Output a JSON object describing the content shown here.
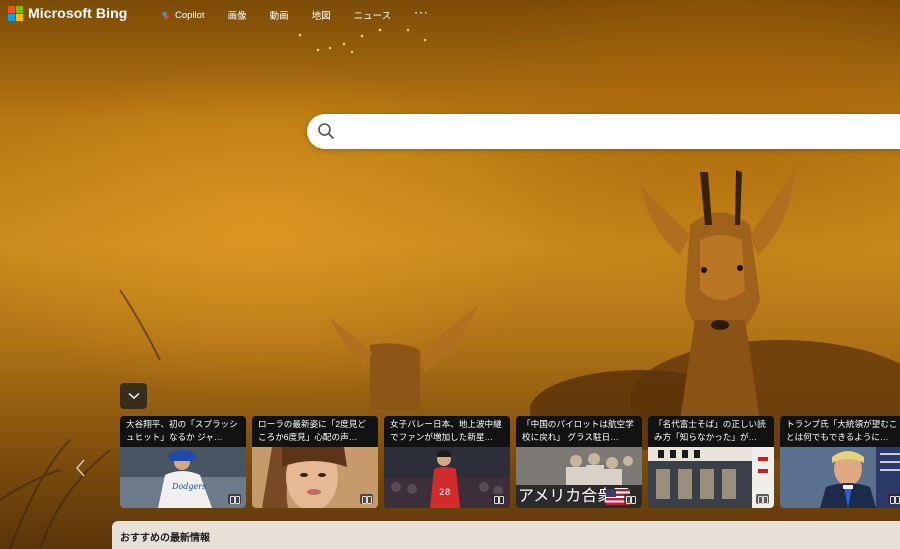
{
  "brand": {
    "name": "Microsoft Bing",
    "logo_colors": [
      "#f25022",
      "#7fba00",
      "#00a4ef",
      "#ffb900"
    ]
  },
  "nav": {
    "items": [
      {
        "label": "Copilot",
        "icon": "copilot-icon"
      },
      {
        "label": "画像"
      },
      {
        "label": "動画"
      },
      {
        "label": "地図"
      },
      {
        "label": "ニュース"
      }
    ],
    "more_label": "···"
  },
  "search": {
    "value": "",
    "placeholder": "",
    "icon": "search-icon"
  },
  "carousel": {
    "collapse_icon": "chevron-down-icon",
    "prev_icon": "chevron-left-icon",
    "cards": [
      {
        "title": "大谷翔平、初の「スプラッシュヒット」なるか ジャ…",
        "image": "baseball-player"
      },
      {
        "title": "ローラの最新姿に「2度見どころか6度見」心配の声…",
        "image": "woman-portrait"
      },
      {
        "title": "女子バレー日本、地上波中継でファンが増加した新星…",
        "image": "volleyball-player"
      },
      {
        "title": "「中国のパイロットは航空学校に戻れ」 グラス駐日…",
        "image": "ambassador-group",
        "image_text": "アメリカ合衆国"
      },
      {
        "title": "「名代富士そば」の正しい読み方「知らなかった」が…",
        "image": "soba-shop-front"
      },
      {
        "title": "トランプ氏「大統領が望むことは何でもできるように…",
        "image": "politician-portrait"
      }
    ]
  },
  "recommended": {
    "title": "おすすめの最新情報"
  }
}
